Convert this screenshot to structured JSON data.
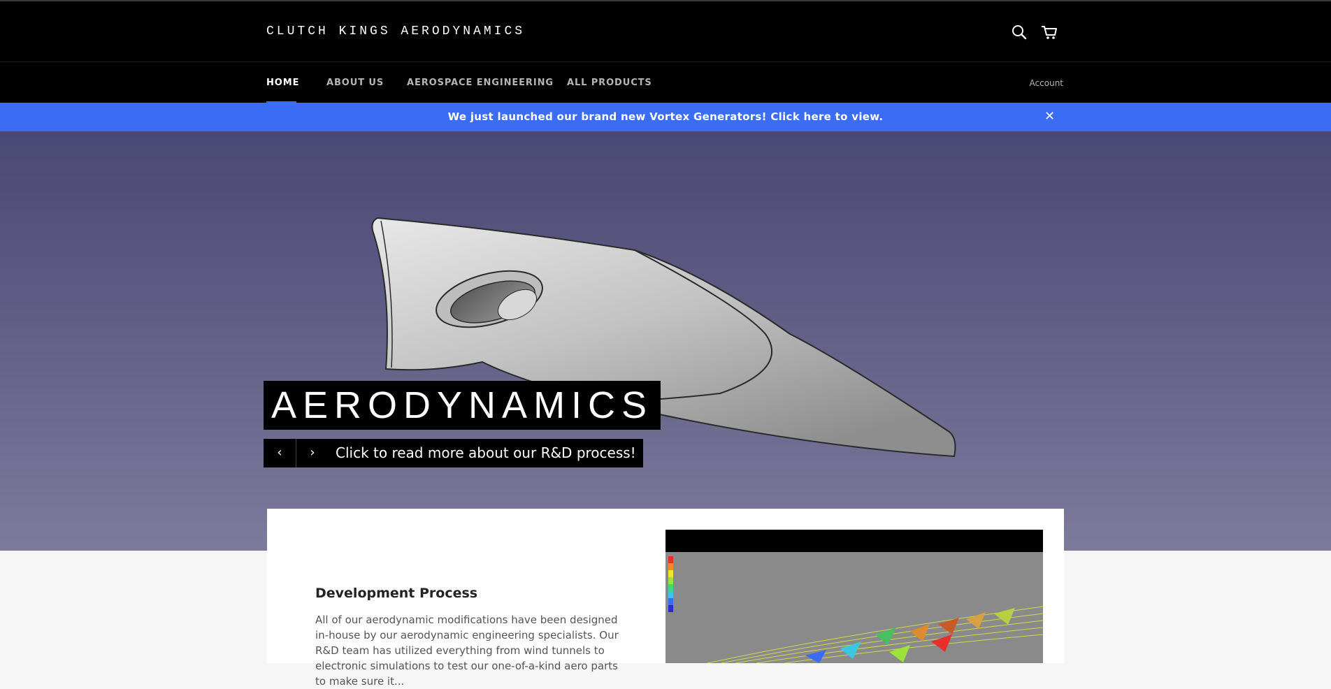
{
  "header": {
    "brand": "CLUTCH KINGS AERODYNAMICS",
    "search_icon": "search-icon",
    "cart_icon": "cart-icon"
  },
  "nav": {
    "items": [
      {
        "label": "HOME",
        "active": true
      },
      {
        "label": "ABOUT US"
      },
      {
        "label": "AEROSPACE ENGINEERING"
      },
      {
        "label": "ALL PRODUCTS"
      }
    ],
    "account": "Account"
  },
  "announcement": {
    "text": "We just launched our brand new Vortex Generators! Click here to view.",
    "close_icon": "close-icon",
    "color": "#3a6cf4"
  },
  "hero": {
    "title": "AERODYNAMICS",
    "link": "Click to read more about our R&D process!",
    "prev_icon": "chevron-left-icon",
    "next_icon": "chevron-right-icon",
    "bg_top": "#4a4874",
    "bg_bottom": "#7d7a9c"
  },
  "content": {
    "title": "Development Process",
    "text": "All of our aerodynamic modifications have been designed in-house by our aerodynamic engineering specialists. Our R&D team has utilized everything from wind tunnels to electronic simulations to test our one-of-a-kind aero parts to make sure it..."
  }
}
